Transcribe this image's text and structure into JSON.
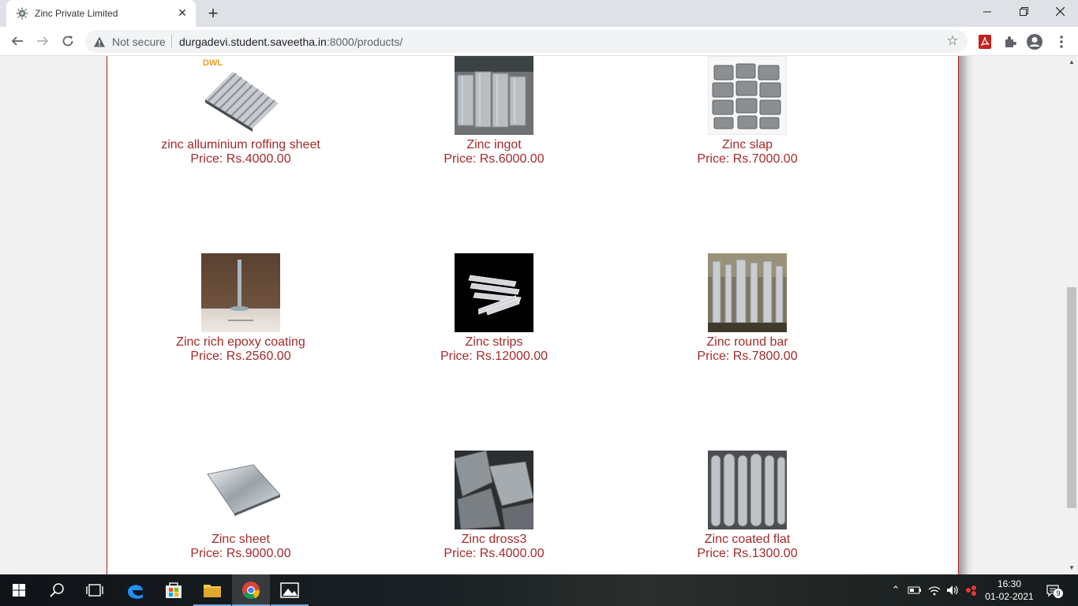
{
  "browser": {
    "tab_title": "Zinc Private Limited",
    "security_label": "Not secure",
    "url_host": "durgadevi.student.saveetha.in",
    "url_rest": ":8000/products/",
    "close_glyph": "✕",
    "newtab_glyph": "+"
  },
  "products": [
    {
      "name": "zinc alluminium roffing sheet",
      "price": "Price: Rs.4000.00",
      "logo": "DWL"
    },
    {
      "name": "Zinc ingot",
      "price": "Price: Rs.6000.00"
    },
    {
      "name": "Zinc slap",
      "price": "Price: Rs.7000.00"
    },
    {
      "name": "Zinc rich epoxy coating",
      "price": "Price: Rs.2560.00"
    },
    {
      "name": "Zinc strips",
      "price": "Price: Rs.12000.00"
    },
    {
      "name": "Zinc round bar",
      "price": "Price: Rs.7800.00"
    },
    {
      "name": "Zinc sheet",
      "price": "Price: Rs.9000.00"
    },
    {
      "name": "Zinc dross3",
      "price": "Price: Rs.4000.00"
    },
    {
      "name": "Zinc coated flat",
      "price": "Price: Rs.1300.00"
    }
  ],
  "taskbar": {
    "time": "16:30",
    "date": "01-02-2021",
    "notification_count": "9"
  },
  "colors": {
    "product_text": "#a52a2a",
    "content_border": "#b22222"
  }
}
